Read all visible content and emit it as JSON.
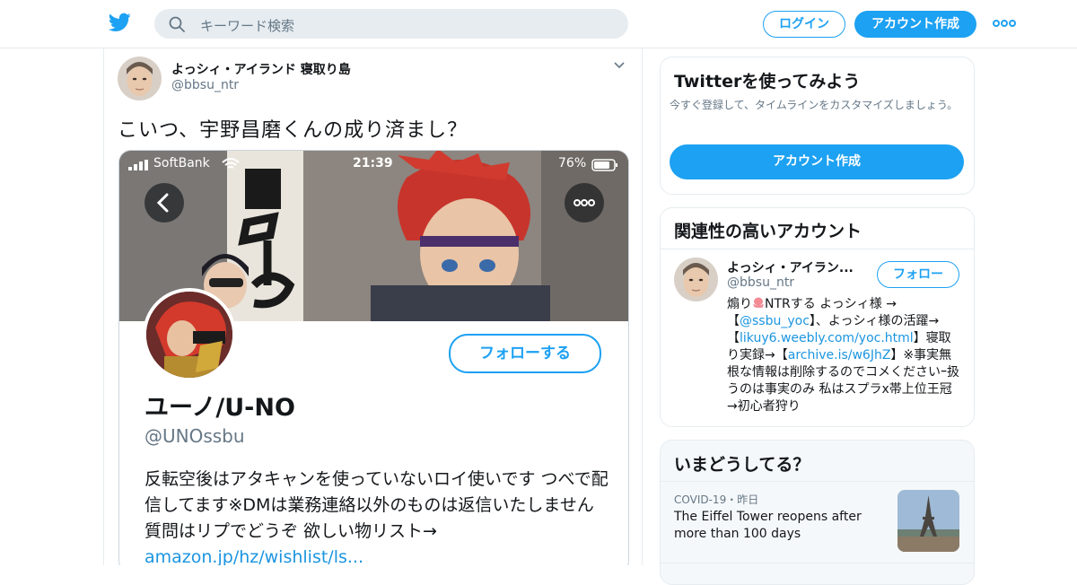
{
  "header": {
    "search_placeholder": "キーワード検索",
    "login_label": "ログイン",
    "signup_label": "アカウント作成"
  },
  "tweet": {
    "author_name": "よっシィ・アイランド 寝取り島",
    "author_handle": "@bbsu_ntr",
    "text": "こいつ、宇野昌磨くんの成り済まし？",
    "media": {
      "status_carrier": "SoftBank",
      "status_time": "21:39",
      "status_battery": "76%",
      "profile_follow_label": "フォローする",
      "profile_name": "ユーノ/U-NO",
      "profile_handle": "@UNOssbu",
      "profile_bio": "反転空後はアタキャンを使っていないロイ使いです つべで配信してます※DMは業務連絡以外のものは返信いたしません 質問はリプでどうぞ 欲しい物リスト→",
      "profile_bio_link": "amazon.jp/hz/wishlist/ls..."
    }
  },
  "sidebar": {
    "signup_card": {
      "title": "Twitterを使ってみよう",
      "description": "今すぐ登録して、タイムラインをカスタマイズしましょう。",
      "button_label": "アカウント作成"
    },
    "related": {
      "title": "関連性の高いアカウント",
      "account": {
        "name": "よっシィ・アイラン...",
        "handle": "@bbsu_ntr",
        "follow_label": "フォロー",
        "bio_part1": "煽り",
        "bio_part2": "NTRする よっシィ様 →【",
        "bio_link1": "@ssbu_yoc",
        "bio_part3": "】、よっシィ様の活躍→【",
        "bio_link2": "likuy6.weebly.com/yoc.html",
        "bio_part4": "】寝取り実録→【",
        "bio_link3": "archive.is/w6JhZ",
        "bio_part5": "】※事実無根な情報は削除するのでコメくださいｰ扱うのは事実のみ 私はスプラx帯上位王冠→初心者狩り"
      }
    },
    "trends": {
      "title": "いまどうしてる？",
      "item": {
        "meta": "COVID-19・昨日",
        "headline": "The Eiffel Tower reopens after more than 100 days"
      }
    }
  },
  "colors": {
    "brand_blue": "#1da1f2",
    "link_blue": "#1b95e0",
    "text_primary": "#14171a",
    "text_secondary": "#657786",
    "border": "#e6ecf0"
  },
  "icons": [
    "twitter-bird-icon",
    "search-icon",
    "more-dots-icon",
    "chevron-down-icon",
    "back-arrow-icon",
    "ellipsis-icon"
  ]
}
